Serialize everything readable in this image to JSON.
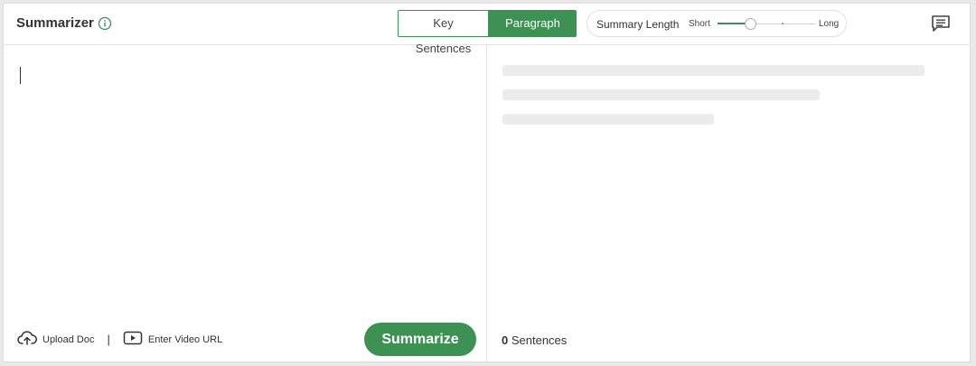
{
  "header": {
    "title": "Summarizer",
    "modes": [
      {
        "label": "Key Sentences",
        "active": false
      },
      {
        "label": "Paragraph",
        "active": true
      }
    ],
    "summary_length": {
      "label": "Summary Length",
      "min_label": "Short",
      "max_label": "Long",
      "level_fraction": 0.33
    }
  },
  "input": {
    "text": ""
  },
  "footer": {
    "upload_label": "Upload Doc",
    "separator": "|",
    "video_label": "Enter Video URL",
    "summarize_label": "Summarize",
    "sentence_count": "0",
    "sentence_label": "Sentences"
  },
  "colors": {
    "accent": "#3d9253",
    "skeleton": "#ececec"
  },
  "icons": {
    "info": "info-icon",
    "comment": "comment-icon",
    "upload": "cloud-upload-icon",
    "video": "play-video-icon"
  }
}
